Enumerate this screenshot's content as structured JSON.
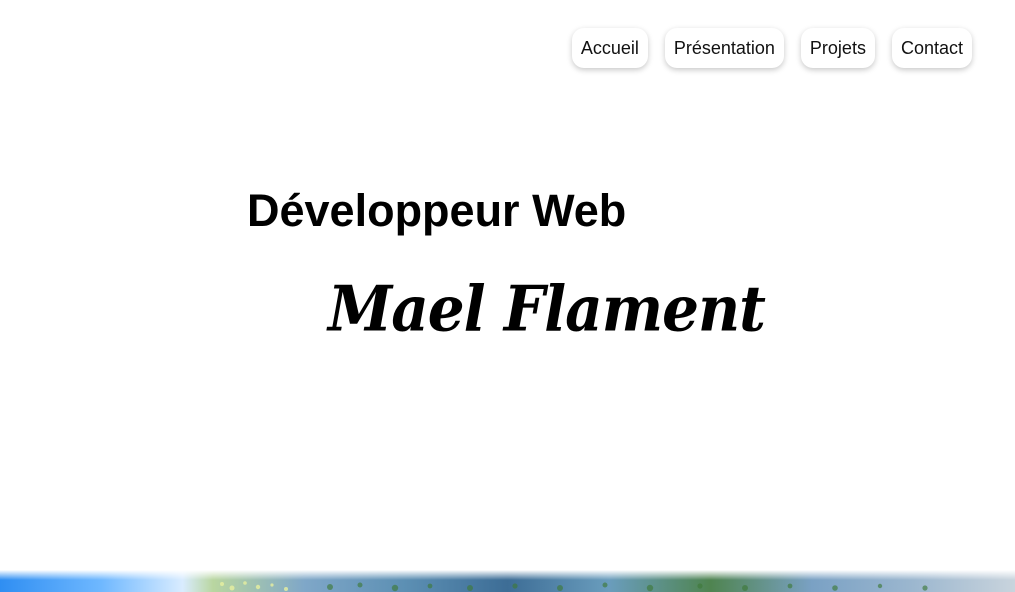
{
  "nav": {
    "items": [
      {
        "label": "Accueil"
      },
      {
        "label": "Présentation"
      },
      {
        "label": "Projets"
      },
      {
        "label": "Contact"
      }
    ]
  },
  "hero": {
    "subtitle": "Développeur Web",
    "name": "Mael Flament"
  }
}
